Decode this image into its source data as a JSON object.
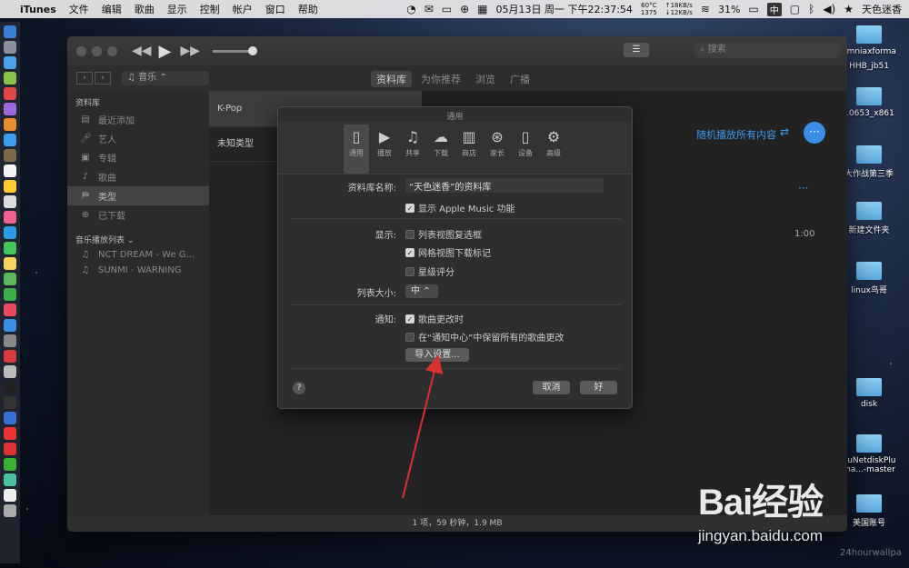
{
  "menubar": {
    "app_name": "iTunes",
    "menus": [
      "文件",
      "编辑",
      "歌曲",
      "显示",
      "控制",
      "帐户",
      "窗口",
      "帮助"
    ],
    "temp": "60°C",
    "fan": "1375",
    "net_up": "↑18KB/s",
    "net_down": "↓12KB/s",
    "datetime": "05月13日 周一 下午22:37:54",
    "battery": "31%",
    "input_method": "中",
    "user": "天色迷香"
  },
  "desktop_icons": [
    "omniaxforma",
    "HHB_jb51",
    "10653_x861",
    "大作战第三季",
    "新建文件夹",
    "linux鸟哥",
    "disk",
    "duNetdiskPlu",
    "ma...-master",
    "美国账号"
  ],
  "itunes": {
    "search_placeholder": "搜索",
    "media_select": "音乐",
    "tabs": [
      "资料库",
      "为你推荐",
      "浏览",
      "广播"
    ],
    "sidebar": {
      "library_header": "资料库",
      "library_items": [
        "最近添加",
        "艺人",
        "专辑",
        "歌曲",
        "类型",
        "已下载"
      ],
      "playlists_header": "音乐播放列表 ⌄",
      "playlists": [
        "NCT DREAM - We G...",
        "SUNMI - WARNING"
      ]
    },
    "genres": [
      "K-Pop",
      "未知类型"
    ],
    "shuffle_label": "随机播放所有内容",
    "duration": "1:00",
    "status": "1 项，59 秒钟，1.9 MB"
  },
  "dialog": {
    "title": "通用",
    "prefs": [
      "通用",
      "播放",
      "共享",
      "下载",
      "商店",
      "家长",
      "设备",
      "高级"
    ],
    "library_name_label": "资料库名称:",
    "library_name_value": "“天色迷香”的资料库",
    "show_apple_music": "显示 Apple Music 功能",
    "show_label": "显示:",
    "list_checkbox": "列表视图复选框",
    "grid_download": "网格视图下载标记",
    "star_rating": "星级评分",
    "list_size_label": "列表大小:",
    "list_size_value": "中",
    "notify_label": "通知:",
    "notify_song": "歌曲更改时",
    "notify_center": "在“通知中心”中保留所有的歌曲更改",
    "import_settings": "导入设置...",
    "cancel": "取消",
    "ok": "好",
    "help": "?"
  },
  "watermark": {
    "brand": "Bai经验",
    "url": "jingyan.baidu.com",
    "corner": "24hourwallpa"
  },
  "colors": {
    "accent": "#3d9bf0",
    "arrow": "#d93030"
  }
}
